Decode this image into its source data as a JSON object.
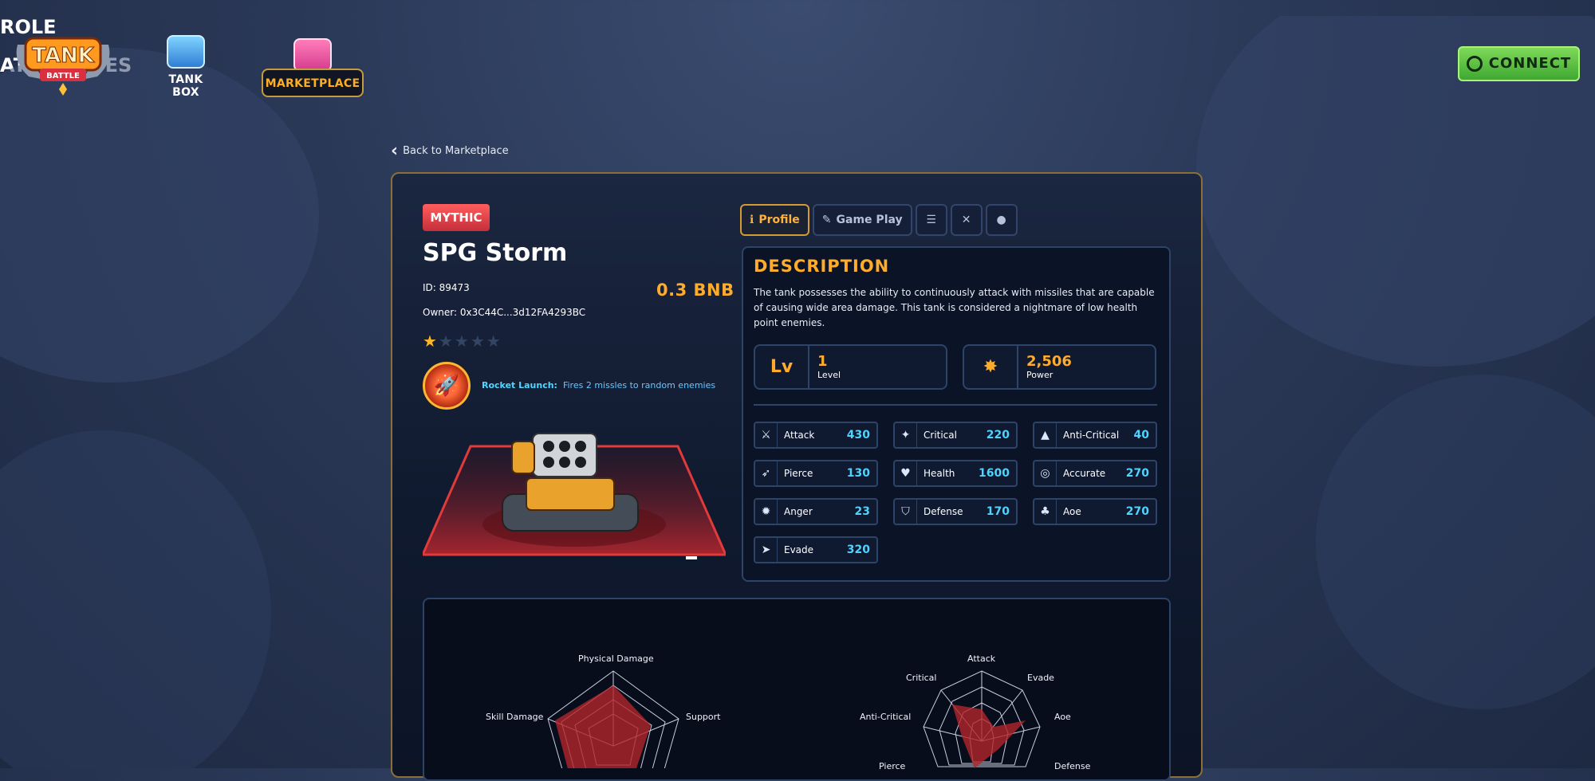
{
  "nav": {
    "logo_text": "TANK BATTLE",
    "tank_box_label": "TANK BOX",
    "marketplace_label": "MARKETPLACE",
    "connect_label": "CONNECT"
  },
  "back_link": "Back to Marketplace",
  "tank": {
    "rarity": "MYTHIC",
    "name": "SPG Storm",
    "id": "ID: 89473",
    "owner": "Owner: 0x3C44C...3d12FA4293BC",
    "price": "0.3 BNB",
    "stars_filled": 1,
    "stars_total": 5,
    "skill_name": "Rocket Launch:",
    "skill_desc": "Fires 2 missles to random enemies"
  },
  "tabs": {
    "profile": "Profile",
    "gameplay": "Game Play"
  },
  "description": {
    "title": "DESCRIPTION",
    "text": "The tank possesses the ability to continuously attack with missiles that are capable of causing wide area damage. This tank is considered a nightmare of low health point enemies."
  },
  "kpis": {
    "level_value": "1",
    "level_label": "Level",
    "level_icon_text": "Lv",
    "power_value": "2,506",
    "power_label": "Power"
  },
  "stats": [
    {
      "label": "Attack",
      "value": "430",
      "icon": "sword-icon"
    },
    {
      "label": "Critical",
      "value": "220",
      "icon": "critical-icon"
    },
    {
      "label": "Anti-Critical",
      "value": "40",
      "icon": "anti-critical-icon"
    },
    {
      "label": "Pierce",
      "value": "130",
      "icon": "pierce-icon"
    },
    {
      "label": "Health",
      "value": "1600",
      "icon": "heart-icon"
    },
    {
      "label": "Accurate",
      "value": "270",
      "icon": "target-icon"
    },
    {
      "label": "Anger",
      "value": "23",
      "icon": "anger-icon"
    },
    {
      "label": "Defense",
      "value": "170",
      "icon": "shield-icon"
    },
    {
      "label": "Aoe",
      "value": "270",
      "icon": "aoe-icon"
    },
    {
      "label": "Evade",
      "value": "320",
      "icon": "evade-icon"
    }
  ],
  "role": {
    "title": "ROLE",
    "labels": [
      "Physical Damage",
      "Support",
      "Skill Damage"
    ]
  },
  "attributes": {
    "title": "ATTRIBUTES",
    "labels": [
      "Attack",
      "Evade",
      "Aoe",
      "Defense",
      "Pierce",
      "Anti-Critical",
      "Critical"
    ]
  },
  "colors": {
    "accent": "#ffab2b",
    "rarity": "#d83a44",
    "connect": "#5cc040",
    "stat_value": "#4fd3ff"
  }
}
